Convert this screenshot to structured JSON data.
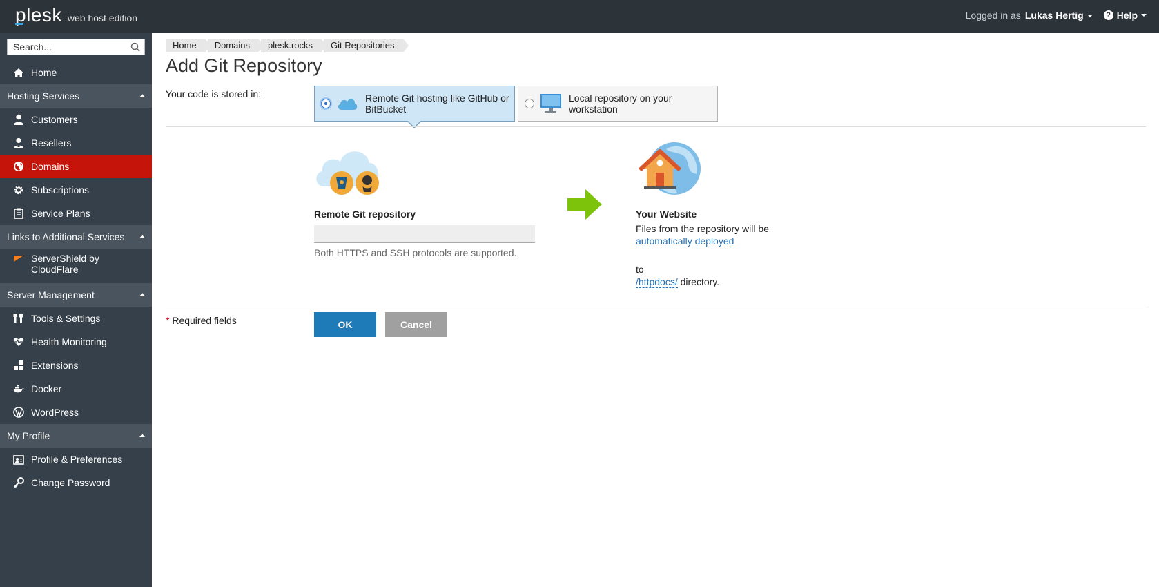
{
  "topbar": {
    "logo_text": "plesk",
    "edition": "web host edition",
    "logged_in_label": "Logged in as",
    "user_name": "Lukas Hertig",
    "help_label": "Help"
  },
  "sidebar": {
    "search_placeholder": "Search...",
    "items": [
      {
        "label": "Home",
        "icon": "home-icon"
      },
      {
        "section": "Hosting Services"
      },
      {
        "label": "Customers",
        "icon": "user-icon"
      },
      {
        "label": "Resellers",
        "icon": "reseller-icon"
      },
      {
        "label": "Domains",
        "icon": "globe-icon",
        "active": true
      },
      {
        "label": "Subscriptions",
        "icon": "gear-icon"
      },
      {
        "label": "Service Plans",
        "icon": "clipboard-icon"
      },
      {
        "section": "Links to Additional Services"
      },
      {
        "label": "ServerShield by CloudFlare",
        "icon": "cloudflare-icon"
      },
      {
        "section": "Server Management"
      },
      {
        "label": "Tools & Settings",
        "icon": "tools-icon"
      },
      {
        "label": "Health Monitoring",
        "icon": "heart-icon"
      },
      {
        "label": "Extensions",
        "icon": "blocks-icon"
      },
      {
        "label": "Docker",
        "icon": "docker-icon"
      },
      {
        "label": "WordPress",
        "icon": "wordpress-icon"
      },
      {
        "section": "My Profile"
      },
      {
        "label": "Profile & Preferences",
        "icon": "profile-icon"
      },
      {
        "label": "Change Password",
        "icon": "key-icon"
      }
    ]
  },
  "breadcrumb": [
    "Home",
    "Domains",
    "plesk.rocks",
    "Git Repositories"
  ],
  "page_title": "Add Git Repository",
  "stored_label": "Your code is stored in:",
  "options": {
    "remote": "Remote Git hosting like GitHub or BitBucket",
    "local": "Local repository on your workstation"
  },
  "remote_section": {
    "title": "Remote Git repository",
    "input_value": "",
    "hint": "Both HTTPS and SSH protocols are supported."
  },
  "website_section": {
    "title": "Your Website",
    "text": "Files from the repository will be",
    "deploy_link": "automatically deployed",
    "to": "to",
    "dir_link": "/httpdocs/",
    "dir_suffix": " directory."
  },
  "form": {
    "required_star": "*",
    "required_label": " Required fields",
    "ok": "OK",
    "cancel": "Cancel"
  },
  "colors": {
    "topbar": "#2c3339",
    "sidebar": "#35404a",
    "section": "#49545e",
    "active": "#c5150b",
    "primary_button": "#1f7ab8",
    "link": "#1e72bd"
  }
}
